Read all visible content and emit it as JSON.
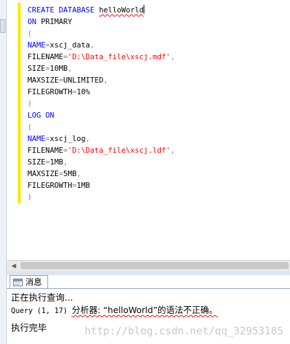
{
  "editor": {
    "lines": [
      {
        "id": "l1",
        "parts": [
          {
            "t": "CREATE",
            "c": "kw"
          },
          {
            "t": " "
          },
          {
            "t": "DATABASE",
            "c": "kw"
          },
          {
            "t": " "
          },
          {
            "t": "helloWorld",
            "c": "squiggle"
          }
        ]
      },
      {
        "id": "l2",
        "parts": [
          {
            "t": "ON",
            "c": "kw"
          },
          {
            "t": " PRIMARY"
          }
        ]
      },
      {
        "id": "l3",
        "parts": [
          {
            "t": "(",
            "c": "gray"
          }
        ]
      },
      {
        "id": "l4",
        "parts": [
          {
            "t": "NAME",
            "c": "kw"
          },
          {
            "t": "=",
            "c": "gray"
          },
          {
            "t": "xscj_data"
          },
          {
            "t": ",",
            "c": "gray"
          }
        ]
      },
      {
        "id": "l5",
        "parts": [
          {
            "t": "FILENAME"
          },
          {
            "t": "=",
            "c": "gray"
          },
          {
            "t": "'D:\\Data_file\\xscj.mdf'",
            "c": "str"
          },
          {
            "t": ",",
            "c": "gray"
          }
        ]
      },
      {
        "id": "l6",
        "parts": [
          {
            "t": "SIZE"
          },
          {
            "t": "=",
            "c": "gray"
          },
          {
            "t": "10MB"
          },
          {
            "t": ",",
            "c": "gray"
          }
        ]
      },
      {
        "id": "l7",
        "parts": [
          {
            "t": "MAXSIZE"
          },
          {
            "t": "=",
            "c": "gray"
          },
          {
            "t": "UNLIMITED"
          },
          {
            "t": ",",
            "c": "gray"
          }
        ]
      },
      {
        "id": "l8",
        "parts": [
          {
            "t": "FILEGROWTH"
          },
          {
            "t": "=",
            "c": "gray"
          },
          {
            "t": "10%"
          }
        ]
      },
      {
        "id": "l9",
        "parts": [
          {
            "t": ")",
            "c": "gray"
          }
        ]
      },
      {
        "id": "l10",
        "parts": [
          {
            "t": "LOG",
            "c": "kw"
          },
          {
            "t": " "
          },
          {
            "t": "ON",
            "c": "kw"
          }
        ]
      },
      {
        "id": "l11",
        "parts": [
          {
            "t": "(",
            "c": "gray"
          }
        ]
      },
      {
        "id": "l12",
        "parts": [
          {
            "t": "NAME",
            "c": "kw"
          },
          {
            "t": "=",
            "c": "gray"
          },
          {
            "t": "xscj_log"
          },
          {
            "t": ",",
            "c": "gray"
          }
        ]
      },
      {
        "id": "l13",
        "parts": [
          {
            "t": "FILENAME"
          },
          {
            "t": "=",
            "c": "gray"
          },
          {
            "t": "'D:\\Data_file\\xscj.ldf'",
            "c": "str"
          },
          {
            "t": ",",
            "c": "gray"
          }
        ]
      },
      {
        "id": "l14",
        "parts": [
          {
            "t": "SIZE"
          },
          {
            "t": "=",
            "c": "gray"
          },
          {
            "t": "1MB"
          },
          {
            "t": ",",
            "c": "gray"
          }
        ]
      },
      {
        "id": "l15",
        "parts": [
          {
            "t": "MAXSIZE"
          },
          {
            "t": "=",
            "c": "gray"
          },
          {
            "t": "5MB"
          },
          {
            "t": ",",
            "c": "gray"
          }
        ]
      },
      {
        "id": "l16",
        "parts": [
          {
            "t": "FILEGROWTH"
          },
          {
            "t": "=",
            "c": "gray"
          },
          {
            "t": "1MB"
          }
        ]
      },
      {
        "id": "l17",
        "parts": [
          {
            "t": ")",
            "c": "gray"
          }
        ]
      }
    ]
  },
  "results": {
    "tab_label": "消息",
    "executing": "正在执行查询...",
    "error_prefix": "Query (1, 17) ",
    "error_text": "分析器: “helloWorld”的语法不正确。",
    "done": "执行完毕"
  },
  "watermark": "http://blog.csdn.net/qq_32953185",
  "colors": {
    "keyword": "#0000ff",
    "string": "#ff0000",
    "operator": "#808080",
    "change_bar": "#ffe600"
  }
}
